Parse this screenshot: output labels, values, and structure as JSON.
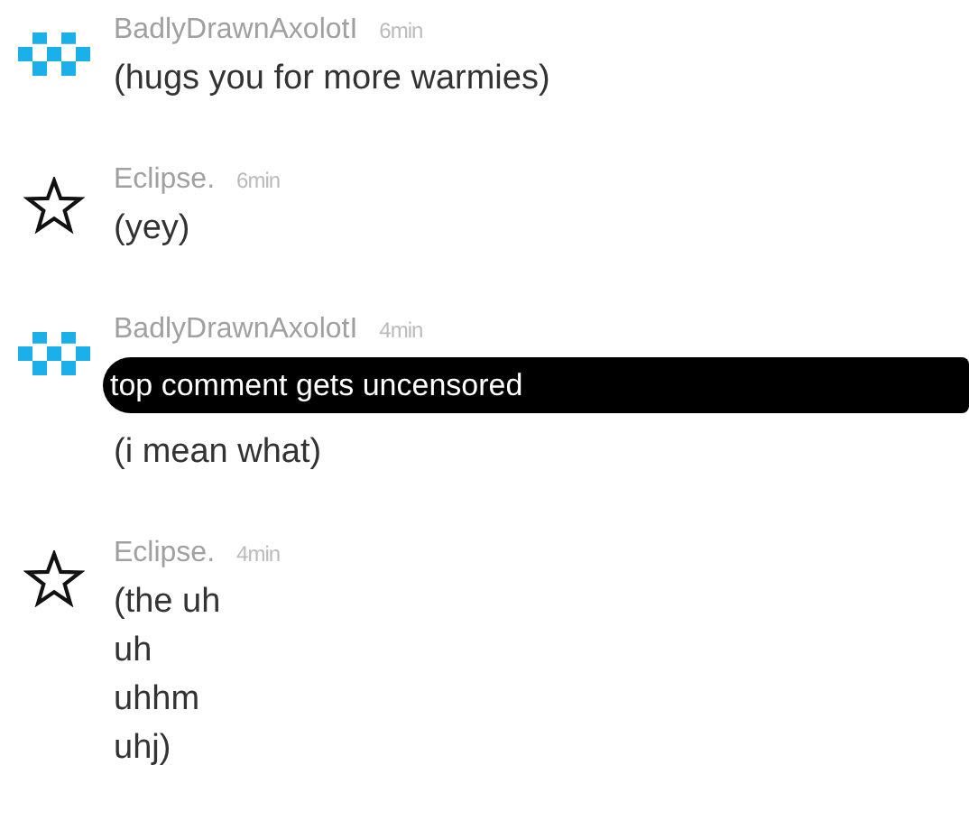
{
  "comments": [
    {
      "kind": "pixel",
      "author": "BadlyDrawnAxolotI",
      "time": "6min",
      "lines": [
        "(hugs you for more warmies)"
      ]
    },
    {
      "kind": "star",
      "author": "Eclipse.",
      "time": "6min",
      "lines": [
        "(yey)"
      ]
    },
    {
      "kind": "pixel",
      "author": "BadlyDrawnAxolotI",
      "time": "4min",
      "redaction": "top comment gets uncensored",
      "lines": [
        "(i mean what)"
      ]
    },
    {
      "kind": "star",
      "author": "Eclipse.",
      "time": "4min",
      "lines": [
        "(the uh",
        "uh",
        "uhhm",
        "uhj)"
      ]
    }
  ]
}
